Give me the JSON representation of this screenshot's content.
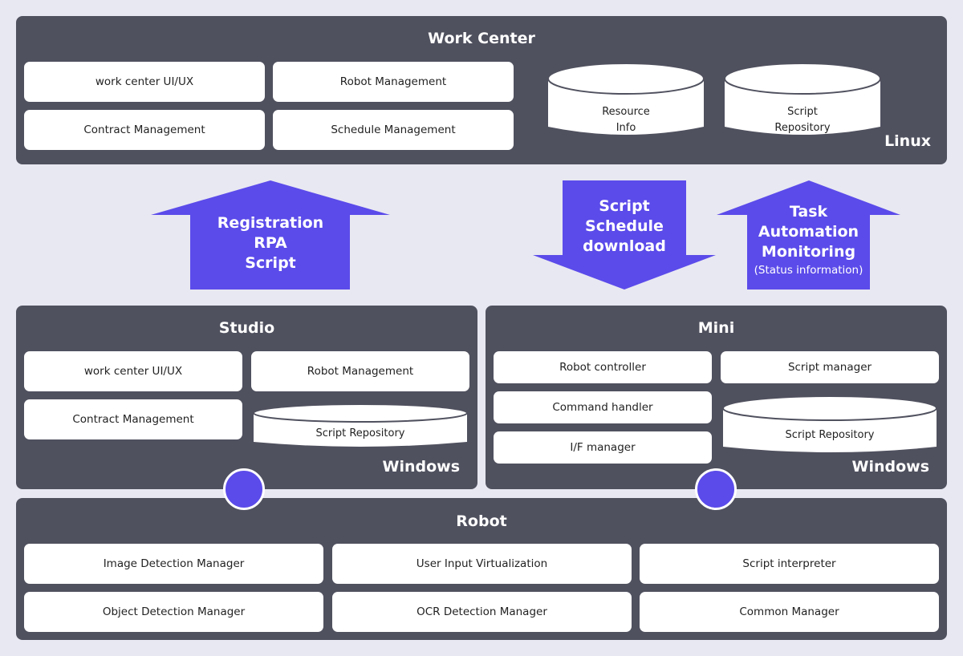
{
  "colors": {
    "background": "#e8e8f2",
    "panel": "#50515f",
    "accent": "#5b4bea",
    "box": "#ffffff",
    "text_dark": "#222222"
  },
  "work_center": {
    "title": "Work Center",
    "os": "Linux",
    "boxes": [
      "work center UI/UX",
      "Robot Management",
      "Contract Management",
      "Schedule Management"
    ],
    "databases": [
      {
        "line1": "Resource",
        "line2": "Info"
      },
      {
        "line1": "Script",
        "line2": "Repository"
      }
    ]
  },
  "arrows": {
    "registration": {
      "direction": "up",
      "lines": [
        "Registration",
        "RPA",
        "Script"
      ]
    },
    "download": {
      "direction": "down",
      "lines": [
        "Script",
        "Schedule",
        "download"
      ]
    },
    "monitoring": {
      "direction": "up",
      "lines": [
        "Task",
        "Automation",
        "Monitoring"
      ],
      "sub": "(Status information)"
    }
  },
  "studio": {
    "title": "Studio",
    "os": "Windows",
    "boxes": [
      "work center UI/UX",
      "Robot Management",
      "Contract Management"
    ],
    "database": "Script Repository"
  },
  "mini": {
    "title": "Mini",
    "os": "Windows",
    "boxes": [
      "Robot controller",
      "Script manager",
      "Command handler",
      "I/F manager"
    ],
    "database": "Script Repository"
  },
  "robot": {
    "title": "Robot",
    "boxes": [
      "Image Detection Manager",
      "User Input Virtualization",
      "Script interpreter",
      "Object Detection Manager",
      "OCR Detection Manager",
      "Common Manager"
    ]
  }
}
